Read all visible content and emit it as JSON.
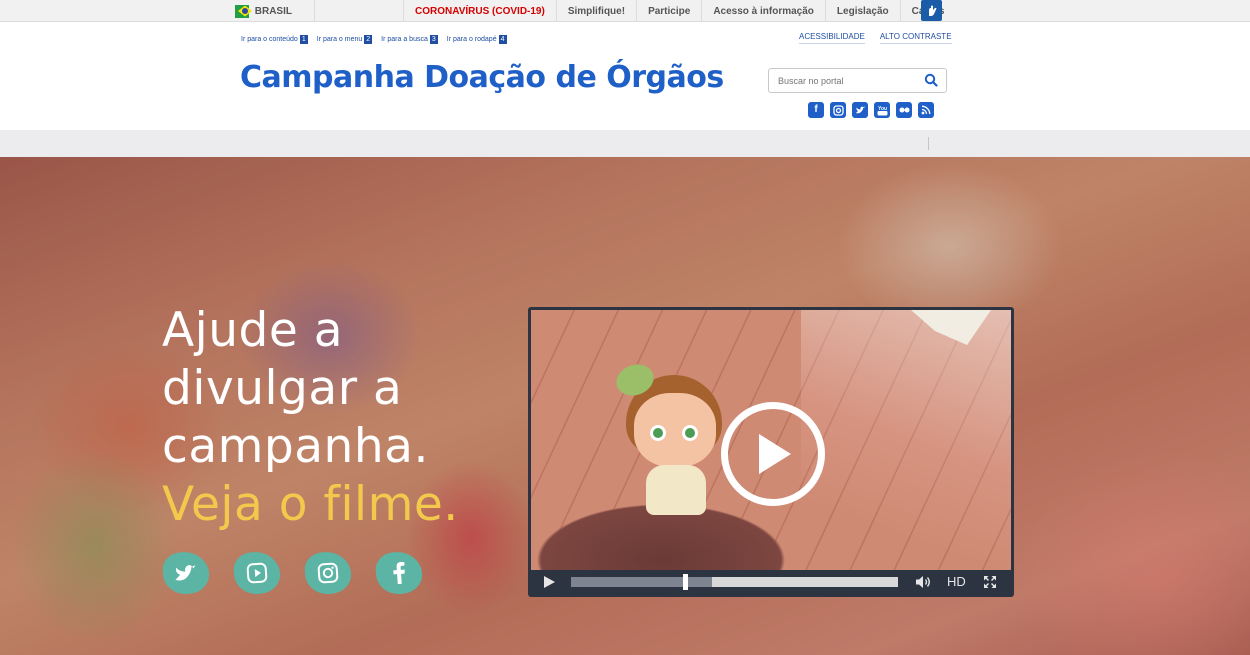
{
  "govbar": {
    "country": "BRASIL",
    "links": [
      "CORONAVÍRUS (COVID-19)",
      "Simplifique!",
      "Participe",
      "Acesso à informação",
      "Legislação",
      "Canais"
    ],
    "covid_color": "#d50000"
  },
  "header": {
    "skip_links": [
      {
        "label": "Ir para o conteúdo",
        "num": "1"
      },
      {
        "label": "Ir para o menu",
        "num": "2"
      },
      {
        "label": "Ir para a busca",
        "num": "3"
      },
      {
        "label": "Ir para o rodapé",
        "num": "4"
      }
    ],
    "accessibility": "ACESSIBILIDADE",
    "high_contrast": "ALTO CONTRASTE",
    "title": "Campanha Doação de Órgãos",
    "title_color": "#1f5fc8",
    "search_placeholder": "Buscar no portal",
    "social_icons": [
      "facebook-icon",
      "instagram-icon",
      "twitter-icon",
      "youtube-icon",
      "flickr-icon",
      "rss-icon"
    ]
  },
  "hero": {
    "lines": [
      "Ajude a",
      "divulgar a",
      "campanha."
    ],
    "highlight": "Veja o filme.",
    "highlight_color": "#f2c94c",
    "social_buttons": [
      "twitter-icon",
      "youtube-icon",
      "instagram-icon",
      "facebook-icon"
    ],
    "button_color": "#5cb4a4"
  },
  "video": {
    "quality_label": "HD",
    "progress_fraction": 0.35,
    "buffered_fraction": 0.43
  }
}
